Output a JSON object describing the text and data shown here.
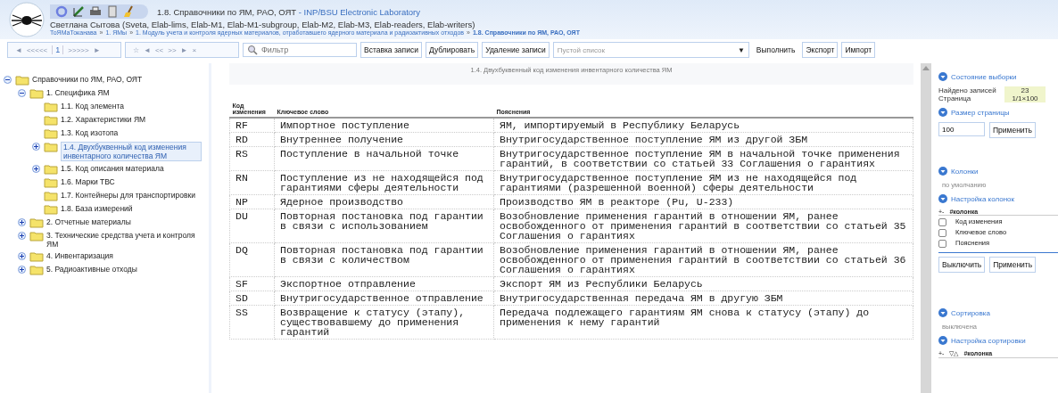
{
  "header": {
    "title": "1.8. Справочники по ЯМ, РАО, ОЯТ",
    "app_name": " - INP/BSU Electronic Laboratory",
    "user": "Светлана Сытова (Sveta, Elab-lims, Elab-M1, Elab-M1-subgroup, Elab-M2, Elab-M3, Elab-readers, Elab-writers)",
    "breadcrumb_separator": "»",
    "breadcrumbs": [
      {
        "label": "ТоЯМаТоканава",
        "current": false
      },
      {
        "label": "1. ЯМы",
        "current": false
      },
      {
        "label": "1. Модуль учета и контроля ядерных материалов, отработавшего ядерного материала и радиоактивных отходов",
        "current": false
      },
      {
        "label": "1.8. Справочники по ЯМ, РАО, ОЯТ",
        "current": true
      }
    ]
  },
  "toolbar": {
    "pager": [
      "◄",
      "<<<<<",
      "1",
      ">>>>>",
      "►"
    ],
    "nav": [
      "☆",
      "◄",
      "<<",
      ">>",
      "►",
      "×"
    ],
    "filter": {
      "placeholder": "Фильтр"
    },
    "buttons_left": [
      "Вставка записи",
      "Дублировать",
      "Удаление записи"
    ],
    "dropdown": {
      "placeholder": "Пустой список",
      "caret": "▼"
    },
    "buttons_right": [
      "Выполнить",
      "Экспорт",
      "Импорт"
    ]
  },
  "tree": [
    {
      "label": "Справочники по ЯМ, РАО, ОЯТ",
      "expanded": true,
      "selected": false,
      "children": [
        {
          "label": "1. Специфика ЯМ",
          "expanded": true,
          "selected": false,
          "children": [
            {
              "label": "1.1. Код элемента",
              "selected": false
            },
            {
              "label": "1.2. Характеристики ЯМ",
              "selected": false
            },
            {
              "label": "1.3. Код изотопа",
              "selected": false
            },
            {
              "label": "1.4. Двухбуквенный код изменения инвентарного количества ЯМ",
              "expanded": false,
              "selected": true
            },
            {
              "label": "1.5. Код описания материала",
              "expanded": false,
              "selected": false
            },
            {
              "label": "1.6. Марки ТВС",
              "selected": false
            },
            {
              "label": "1.7. Контейнеры для транспортировки",
              "selected": false
            },
            {
              "label": "1.8. База измерений",
              "selected": false
            }
          ]
        },
        {
          "label": "2. Отчетные материалы",
          "expanded": false,
          "selected": false
        },
        {
          "label": "3. Технические средства учета и контроля ЯМ",
          "expanded": false,
          "selected": false
        },
        {
          "label": "4. Инвентаризация",
          "expanded": false,
          "selected": false
        },
        {
          "label": "5. Радиоактивные отходы",
          "expanded": false,
          "selected": false
        }
      ]
    }
  ],
  "table": {
    "caption": "1.4. Двухбуквенный код изменения инвентарного количества ЯМ",
    "columns": [
      "Код изменения",
      "Ключевое слово",
      "Пояснения"
    ],
    "rows": [
      [
        "RF",
        "Импортное поступление",
        "ЯМ, импортируемый в Республику Беларусь"
      ],
      [
        "RD",
        "Внутреннее получение",
        "Внутригосударственное поступление ЯМ из другой ЗБМ"
      ],
      [
        "RS",
        "Поступление в начальной точке",
        "Внутригосударственное поступление ЯМ в начальной точке применения гарантий, в соответствии со статьей 33 Соглашения о гарантиях"
      ],
      [
        "RN",
        "Поступление из не находящейся под гарантиями сферы деятельности",
        "Внутригосударственное поступление ЯМ из не находящейся под гарантиями (разрешенной военной) сферы деятельности"
      ],
      [
        "NP",
        "Ядерное производство",
        "Производство ЯМ в реакторе (Pu, U-233)"
      ],
      [
        "DU",
        "Повторная постановка под гарантии в связи с использованием",
        "Возобновление применения гарантий в отношении ЯМ, ранее освобожденного от применения гарантий в соответствии со статьей 35 Соглашения о гарантиях"
      ],
      [
        "DQ",
        "Повторная постановка под гарантии в связи с количеством",
        "Возобновление применения гарантий в отношении ЯМ, ранее освобожденного от применения гарантий в соответствии со статьей 36 Соглашения о гарантиях"
      ],
      [
        "SF",
        "Экспортное отправление",
        "Экспорт ЯМ из Республики Беларусь"
      ],
      [
        "SD",
        "Внутригосударственное отправление",
        "Внутригосударственная передача ЯМ в другую ЗБМ"
      ],
      [
        "SS",
        "Возвращение к статусу (этапу), существовавшему до применения гарантий",
        "Передача подлежащего гарантиям ЯМ снова к статусу (этапу) до применения к нему гарантий"
      ]
    ]
  },
  "side": {
    "selection": {
      "title": "Состояние выборки",
      "stats": [
        {
          "label": "Найдено записей",
          "value": "23"
        },
        {
          "label": "Страница",
          "value": "1/1×100"
        }
      ]
    },
    "page_size": {
      "title": "Размер страницы",
      "value": "100",
      "button": "Применить"
    },
    "columns": {
      "title": "Колонки",
      "note": "по умолчанию"
    },
    "column_setup": {
      "title": "Настройка колонок",
      "head_icons": "+-",
      "head": "#колонка",
      "items": [
        {
          "label": "Код изменения",
          "checked": false
        },
        {
          "label": "Ключевое слово",
          "checked": false
        },
        {
          "label": "Пояснения",
          "checked": false
        }
      ],
      "buttons": [
        "Выключить",
        "Применить"
      ]
    },
    "sorting": {
      "title": "Сортировка",
      "note": "выключена"
    },
    "sort_setup": {
      "title": "Настройка сортировки",
      "head_icons": "+-",
      "sort_icon": "▽△",
      "head": "#колонка"
    }
  }
}
